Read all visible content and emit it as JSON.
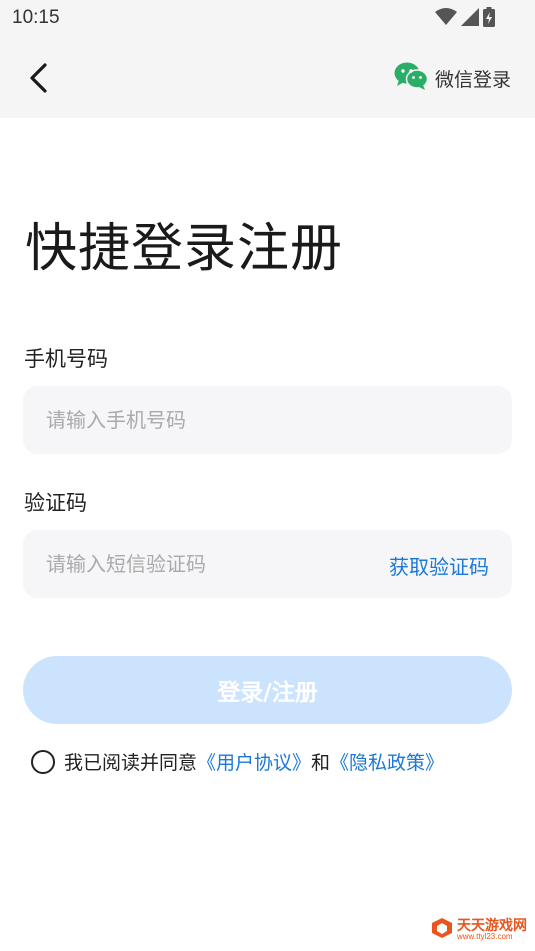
{
  "status_bar": {
    "time": "10:15"
  },
  "header": {
    "wechat_login_label": "微信登录"
  },
  "title": "快捷登录注册",
  "phone": {
    "label": "手机号码",
    "placeholder": "请输入手机号码",
    "value": ""
  },
  "code": {
    "label": "验证码",
    "placeholder": "请输入短信验证码",
    "value": "",
    "get_code_label": "获取验证码"
  },
  "login_button_label": "登录/注册",
  "agreement": {
    "checked": false,
    "prefix": "我已阅读并同意",
    "user_agreement": "《用户协议》",
    "and": "和",
    "privacy_policy": "《隐私政策》"
  },
  "watermark": {
    "main": "天天游戏网",
    "sub": "www.ttyl23.com"
  },
  "colors": {
    "accent": "#1b78d8",
    "button_disabled": "#cce3fe",
    "wechat_green": "#2aae67",
    "header_bg": "#f5f5f5",
    "input_bg": "#f6f6f8"
  },
  "icons": {
    "back": "chevron-left-icon",
    "wechat": "wechat-icon",
    "wifi": "wifi-icon",
    "signal": "signal-icon",
    "battery": "battery-icon"
  }
}
